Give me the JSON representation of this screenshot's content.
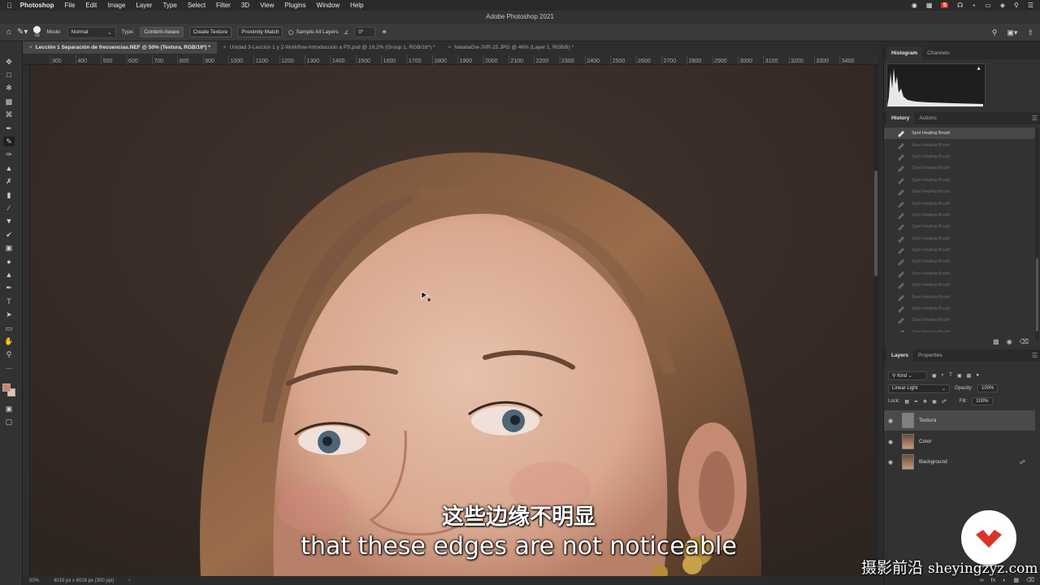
{
  "menubar": {
    "app": "Photoshop",
    "items": [
      "File",
      "Edit",
      "Image",
      "Layer",
      "Type",
      "Select",
      "Filter",
      "3D",
      "View",
      "Plugins",
      "Window",
      "Help"
    ],
    "status_badge": "S"
  },
  "window": {
    "title": "Adobe Photoshop 2021"
  },
  "options": {
    "brush_size": "65",
    "mode_label": "Mode:",
    "mode_value": "Normal",
    "type_label": "Type:",
    "type_buttons": [
      "Content-Aware",
      "Create Texture",
      "Proximity Match"
    ],
    "sample_all_layers": "Sample All Layers",
    "angle": "0°"
  },
  "tabs": [
    {
      "label": "Lección 1 Separación de frecuencias.NEF @ 50% (Textura, RGB/16*) *"
    },
    {
      "label": "Unidad 3-Lección 1 y 2-Workflow-Introducción a PS.psd @ 16,2% (Group 1, RGB/16*) *"
    },
    {
      "label": "NataliaGw-JVR-25.JPG @ 46% (Layer 1, RGB/8) *"
    }
  ],
  "ruler_labels": [
    "300",
    "400",
    "500",
    "600",
    "700",
    "800",
    "900",
    "1000",
    "1100",
    "1200",
    "1300",
    "1400",
    "1500",
    "1600",
    "1700",
    "1800",
    "1900",
    "2000",
    "2100",
    "2200",
    "2300",
    "2400",
    "2500",
    "2600",
    "2700",
    "2800",
    "2900",
    "3000",
    "3100",
    "3200",
    "3300",
    "3400"
  ],
  "statusbar": {
    "zoom": "50%",
    "doc_info": "4016 px x 6016 px (300 ppi)"
  },
  "subtitles": {
    "cn": "这些边缘不明显",
    "en": "that these edges are not noticeable"
  },
  "panels": {
    "histogram_tabs": [
      "Histogram",
      "Channels"
    ],
    "history_tabs": [
      "History",
      "Actions"
    ],
    "history_items": [
      "Spot Healing Brush",
      "Spot Healing Brush",
      "Spot Healing Brush",
      "Spot Healing Brush",
      "Spot Healing Brush",
      "Spot Healing Brush",
      "Spot Healing Brush",
      "Spot Healing Brush",
      "Spot Healing Brush",
      "Spot Healing Brush",
      "Spot Healing Brush",
      "Spot Healing Brush",
      "Spot Healing Brush",
      "Spot Healing Brush",
      "Spot Healing Brush",
      "Spot Healing Brush",
      "Spot Healing Brush",
      "Spot Healing Brush"
    ],
    "layers_tabs": [
      "Layers",
      "Properties"
    ],
    "kind_label": "Kind",
    "blend_mode": "Linear Light",
    "opacity_label": "Opacity:",
    "opacity_value": "100%",
    "lock_label": "Lock:",
    "fill_label": "Fill:",
    "fill_value": "100%",
    "layers": [
      {
        "name": "Textura",
        "selected": true
      },
      {
        "name": "Color",
        "selected": false
      },
      {
        "name": "Background",
        "selected": false,
        "locked": true
      }
    ]
  },
  "watermark": {
    "cn": "摄影前沿",
    "latin": "sheyingzyz.com"
  },
  "colors": {
    "accent": "#d8352a",
    "canvas_bg": "#3c302a",
    "foreground_swatch": "#c9836f",
    "background_swatch": "#e2c2b0"
  }
}
